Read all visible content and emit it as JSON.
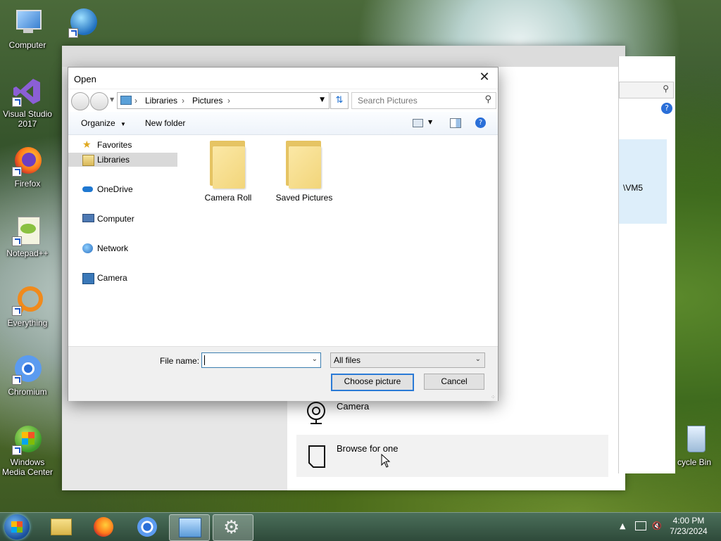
{
  "desktop": {
    "icons": [
      {
        "label": "Computer",
        "icon": "computer-icon"
      },
      {
        "label": "Visual Studio 2017",
        "icon": "visual-studio-icon"
      },
      {
        "label": "Firefox",
        "icon": "firefox-icon"
      },
      {
        "label": "Notepad++",
        "icon": "notepad-plus-plus-icon"
      },
      {
        "label": "Everything",
        "icon": "everything-search-icon"
      },
      {
        "label": "Chromium",
        "icon": "chromium-icon"
      },
      {
        "label": "Windows Media Center",
        "icon": "windows-media-center-icon"
      }
    ],
    "recycle_bin_label": "cycle Bin"
  },
  "background_window": {
    "partial_path_text": "\\VM5",
    "options": [
      {
        "label": "Camera",
        "icon": "webcam-icon"
      },
      {
        "label": "Browse for one",
        "icon": "file-icon"
      }
    ]
  },
  "dialog": {
    "title": "Open",
    "address": {
      "segments": [
        "Libraries",
        "Pictures"
      ]
    },
    "search_placeholder": "Search Pictures",
    "toolbar": {
      "organize": "Organize",
      "new_folder": "New folder"
    },
    "nav_pane": [
      {
        "label": "Favorites",
        "icon": "star-icon"
      },
      {
        "label": "Libraries",
        "icon": "libraries-icon",
        "selected": true
      },
      {
        "label": "OneDrive",
        "icon": "onedrive-cloud-icon"
      },
      {
        "label": "Computer",
        "icon": "computer-icon"
      },
      {
        "label": "Network",
        "icon": "network-icon"
      },
      {
        "label": "Camera",
        "icon": "camera-icon"
      }
    ],
    "folders": [
      {
        "label": "Camera Roll"
      },
      {
        "label": "Saved Pictures"
      }
    ],
    "file_name_label": "File name:",
    "file_name_value": "",
    "file_type": "All files",
    "choose_button": "Choose picture",
    "cancel_button": "Cancel"
  },
  "taskbar": {
    "time": "4:00 PM",
    "date": "7/23/2024"
  },
  "colors": {
    "accent": "#2a7ad6",
    "selection": "#d9d9d9",
    "folder": "#f2d57a"
  }
}
